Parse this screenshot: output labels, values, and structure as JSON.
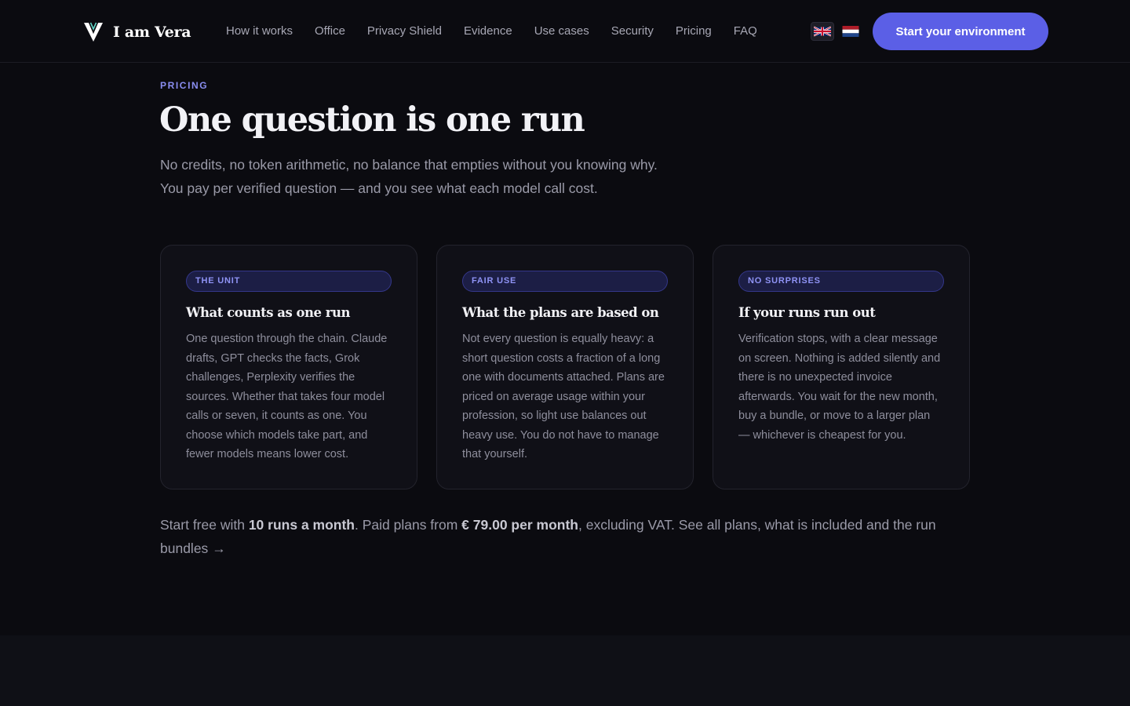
{
  "brand": {
    "name": "I am Vera"
  },
  "nav": {
    "items": [
      "How it works",
      "Office",
      "Privacy Shield",
      "Evidence",
      "Use cases",
      "Security",
      "Pricing",
      "FAQ"
    ]
  },
  "languages": [
    {
      "flag_icon": "uk-flag-icon",
      "active": true
    },
    {
      "flag_icon": "nl-flag-icon",
      "active": false
    }
  ],
  "cta": {
    "label": "Start your environment"
  },
  "section": {
    "eyebrow": "PRICING",
    "title": "One question is one run",
    "lead": "No credits, no token arithmetic, no balance that empties without you knowing why. You pay per verified question — and you see what each model call cost."
  },
  "cards": [
    {
      "badge": "THE UNIT",
      "title": "What counts as one run",
      "body": "One question through the chain. Claude drafts, GPT checks the facts, Grok challenges, Perplexity verifies the sources. Whether that takes four model calls or seven, it counts as one. You choose which models take part, and fewer models means lower cost."
    },
    {
      "badge": "FAIR USE",
      "title": "What the plans are based on",
      "body": "Not every question is equally heavy: a short question costs a fraction of a long one with documents attached. Plans are priced on average usage within your profession, so light use balances out heavy use. You do not have to manage that yourself."
    },
    {
      "badge": "NO SURPRISES",
      "title": "If your runs run out",
      "body": "Verification stops, with a clear message on screen. Nothing is added silently and there is no unexpected invoice afterwards. You wait for the new month, buy a bundle, or move to a larger plan — whichever is cheapest for you."
    }
  ],
  "footnote": {
    "prefix": "Start free with ",
    "free_runs": "10 runs a month",
    "middle": ". Paid plans from ",
    "price": "€ 79.00 per month",
    "suffix": ", excluding VAT. ",
    "link": "See all plans, what is included and the run bundles",
    "arrow": "→"
  },
  "colors": {
    "background": "#0b0b10",
    "accent": "#5b5fe6",
    "eyebrow": "#8a8ef0"
  }
}
